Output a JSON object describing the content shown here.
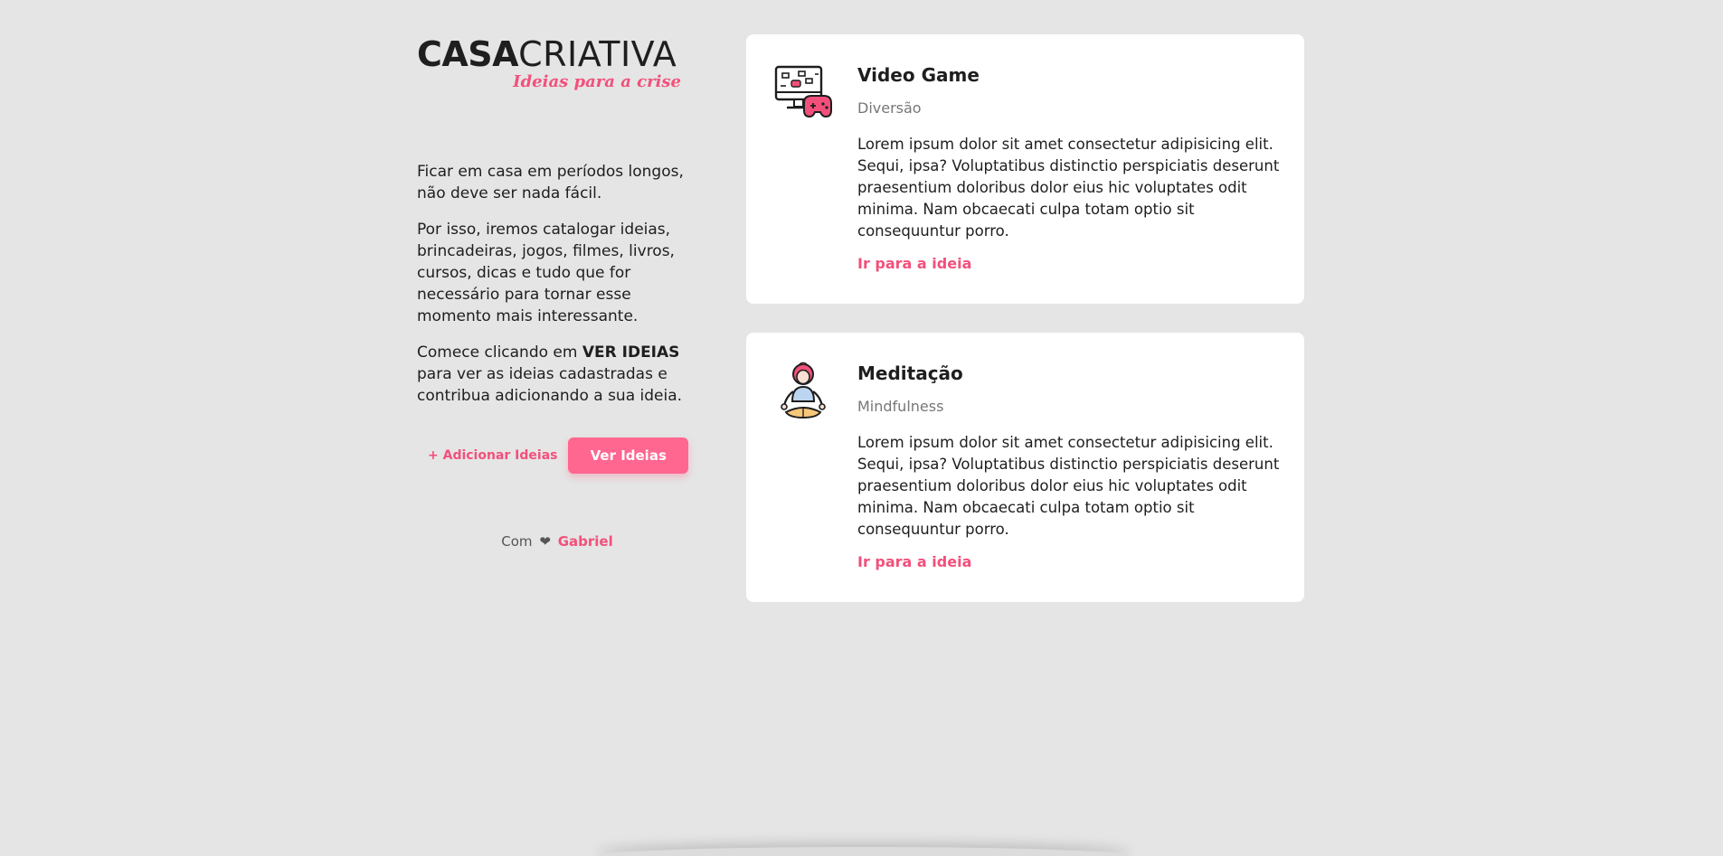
{
  "logo": {
    "main_bold": "CASA",
    "main_light": "CRIATIVA",
    "tagline": "Ideias para a crise"
  },
  "intro": {
    "paragraph1": "Ficar em casa em períodos longos, não deve ser nada fácil.",
    "paragraph2": "Por isso, iremos catalogar ideias, brincadeiras, jogos, filmes, livros, cursos, dicas e tudo que for necessário para tornar esse momento mais interessante.",
    "paragraph3_before": "Comece clicando em ",
    "paragraph3_strong": "VER IDEIAS",
    "paragraph3_after": " para ver as ideias cadastradas e contribua adicionando a sua ideia."
  },
  "actions": {
    "add_label": "+ Adicionar Ideias",
    "view_label": "Ver Ideias"
  },
  "credit": {
    "prefix": "Com",
    "heart": "❤",
    "author": "Gabriel"
  },
  "ideas": [
    {
      "title": "Video Game",
      "category": "Diversão",
      "description": "Lorem ipsum dolor sit amet consectetur adipisicing elit. Sequi, ipsa? Voluptatibus distinctio perspiciatis deserunt praesentium doloribus dolor eius hic voluptates odit minima. Nam obcaecati culpa totam optio sit consequuntur porro.",
      "link_label": "Ir para a ideia",
      "icon": "video-game-icon"
    },
    {
      "title": "Meditação",
      "category": "Mindfulness",
      "description": "Lorem ipsum dolor sit amet consectetur adipisicing elit. Sequi, ipsa? Voluptatibus distinctio perspiciatis deserunt praesentium doloribus dolor eius hic voluptates odit minima. Nam obcaecati culpa totam optio sit consequuntur porro.",
      "link_label": "Ir para a ideia",
      "icon": "meditation-icon"
    }
  ],
  "colors": {
    "background": "#e5e5e5",
    "accent": "#f2507b",
    "button": "#ff6690",
    "card": "#ffffff"
  }
}
